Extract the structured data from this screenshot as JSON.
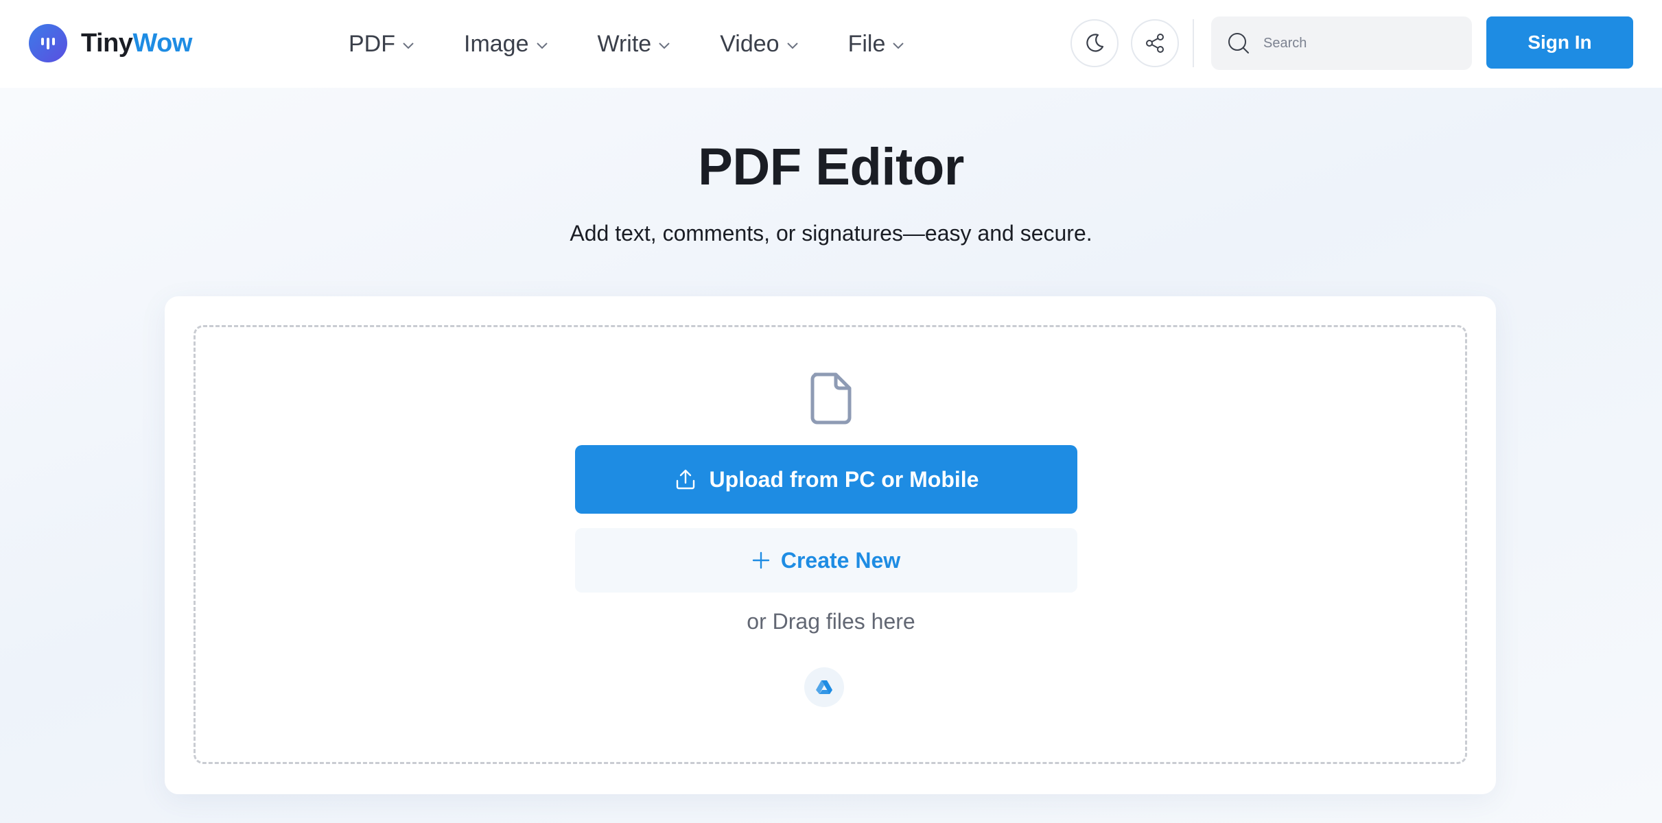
{
  "brand": {
    "name_part1": "Tiny",
    "name_part2": "Wow"
  },
  "nav": [
    {
      "label": "PDF"
    },
    {
      "label": "Image"
    },
    {
      "label": "Write"
    },
    {
      "label": "Video"
    },
    {
      "label": "File"
    }
  ],
  "header": {
    "theme_icon": "moon-icon",
    "share_icon": "share-icon",
    "search_placeholder": "Search",
    "search_value": "",
    "signin_label": "Sign In"
  },
  "page": {
    "title": "PDF Editor",
    "subtitle": "Add text, comments, or signatures—easy and secure."
  },
  "uploader": {
    "file_icon": "document-icon",
    "upload_label": "Upload from PC or Mobile",
    "create_label": "Create New",
    "drag_text": "or Drag files here",
    "cloud_icon": "google-drive-icon"
  },
  "colors": {
    "accent": "#1e8ce3",
    "text": "#1a1d24",
    "background": "#f5f8fc"
  }
}
